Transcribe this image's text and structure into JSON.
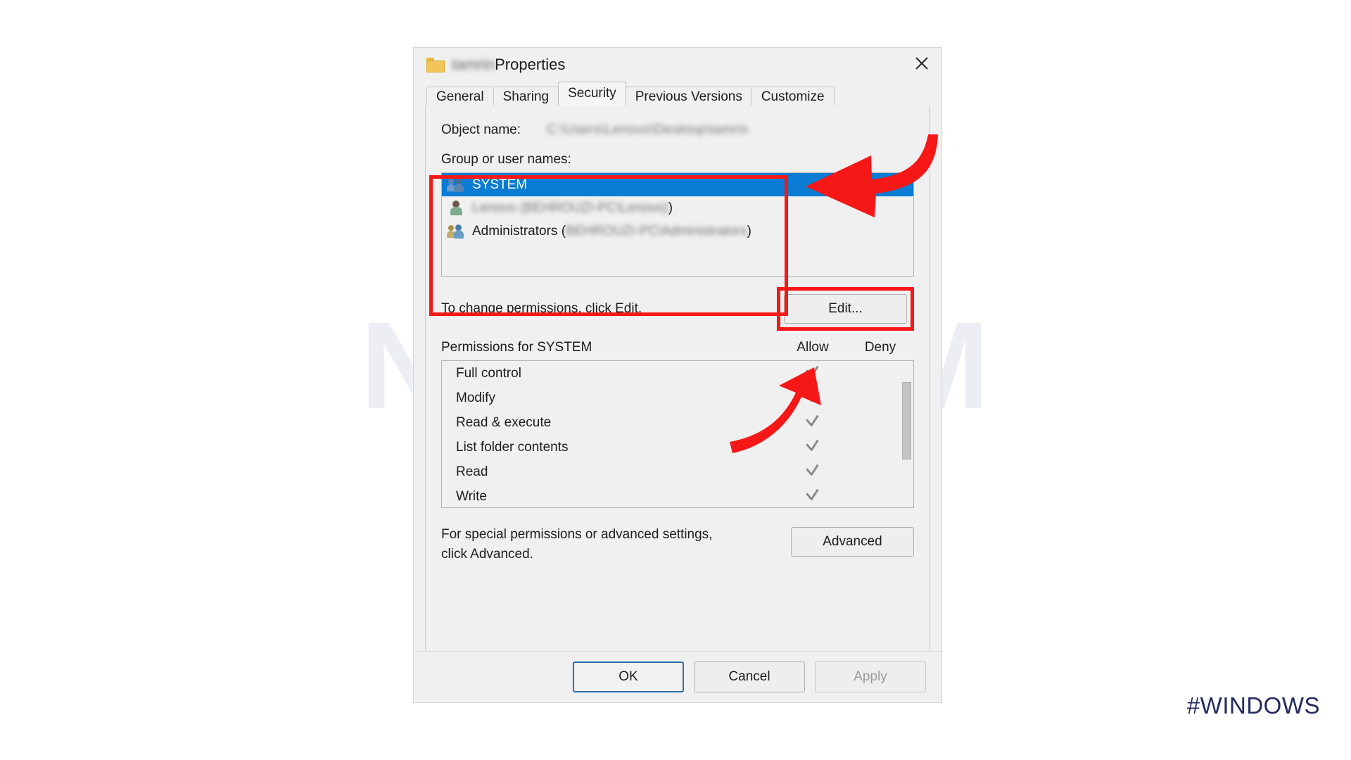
{
  "window": {
    "title_prefix_blurred": "tamrin",
    "title": "Properties",
    "folder_icon": "folder-icon",
    "close_icon": "close-icon"
  },
  "tabs": [
    {
      "label": "General",
      "active": false
    },
    {
      "label": "Sharing",
      "active": false
    },
    {
      "label": "Security",
      "active": true
    },
    {
      "label": "Previous Versions",
      "active": false
    },
    {
      "label": "Customize",
      "active": false
    }
  ],
  "object_name": {
    "label": "Object name:",
    "value_blurred": "C:\\Users\\Lenovo\\Desktop\\tamrin"
  },
  "group_section": {
    "label": "Group or user names:",
    "items": [
      {
        "name": "SYSTEM",
        "blurred_suffix": "",
        "selected": true,
        "icon": "group-users-icon"
      },
      {
        "name": "",
        "blurred_suffix": "Lenovo (BEHROUZI-PC\\Lenovo)",
        "selected": false,
        "icon": "single-user-icon",
        "trailing": ")"
      },
      {
        "name": "Administrators (",
        "blurred_suffix": "BEHROUZI-PC\\Administrators",
        "selected": false,
        "icon": "group-users-icon",
        "trailing": ")"
      }
    ]
  },
  "edit_row": {
    "note": "To change permissions, click Edit.",
    "button_label": "Edit..."
  },
  "permissions": {
    "header_title": "Permissions for SYSTEM",
    "col_allow": "Allow",
    "col_deny": "Deny",
    "rows": [
      {
        "name": "Full control",
        "allow": true,
        "deny": false
      },
      {
        "name": "Modify",
        "allow": true,
        "deny": false
      },
      {
        "name": "Read & execute",
        "allow": true,
        "deny": false
      },
      {
        "name": "List folder contents",
        "allow": true,
        "deny": false
      },
      {
        "name": "Read",
        "allow": true,
        "deny": false
      },
      {
        "name": "Write",
        "allow": true,
        "deny": false
      }
    ]
  },
  "advanced_row": {
    "note_line1": "For special permissions or advanced settings,",
    "note_line2": "click Advanced.",
    "button_label": "Advanced"
  },
  "footer": {
    "ok": "OK",
    "cancel": "Cancel",
    "apply": "Apply",
    "apply_disabled": true
  },
  "annotations": {
    "arrow_top": "red-curved-arrow-left",
    "arrow_edit": "red-curved-arrow-up",
    "highlight_color": "#f61717"
  },
  "watermark": {
    "text": "NeuronVM"
  },
  "hashtag": {
    "text": "#WINDOWS",
    "color": "#23295e"
  }
}
